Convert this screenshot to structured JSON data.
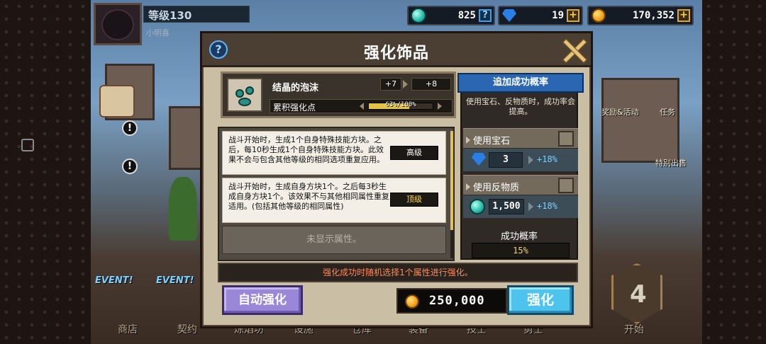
{
  "player": {
    "level": "等级130",
    "name": "小明喜"
  },
  "currency": [
    {
      "icon": "teal-gem-icon",
      "value": "825",
      "button": "?"
    },
    {
      "icon": "blue-diamond-icon",
      "value": "19",
      "button": "+"
    },
    {
      "icon": "gold-coin-icon",
      "value": "170,352",
      "button": "+"
    }
  ],
  "background": {
    "events": [
      "EVENT!",
      "EVENT!"
    ],
    "nav": [
      "商店",
      "契约",
      "炼焰坊",
      "设施",
      "仓库",
      "装备",
      "技士",
      "勇士",
      "开始"
    ],
    "side": [
      "奖励&活动",
      "任务",
      "特别出售"
    ],
    "start_number": "4"
  },
  "modal": {
    "title": "强化饰品",
    "help": "?",
    "item": {
      "name": "结晶的泡沫",
      "level_from": "+7",
      "level_to": "+8",
      "points_label": "累积强化点",
      "progress_text": "63%/100%",
      "progress_percent": 63
    },
    "effects": [
      {
        "text": "战斗开始时，生成1个自身特殊技能方块。之后，每10秒生成1个自身特殊技能方块。此效果不会与包含其他等级的相同选项重复应用。",
        "grade": "高级",
        "grade_color": "#ffffff"
      },
      {
        "text": "战斗开始时，生成自身方块1个。之后每3秒生成自身方块1个。该效果不与其他相同属性重复适用。(包括其他等级的相同属性)",
        "grade": "顶级",
        "grade_color": "#ffd84a"
      }
    ],
    "hidden_effect": "未显示属性。",
    "bonus": {
      "title": "追加成功概率",
      "desc": "使用宝石、反物质时，成功率会提高。",
      "gem_label": "使用宝石",
      "gem_amount": "3",
      "gem_bonus": "+18%",
      "antimatter_label": "使用反物质",
      "antimatter_amount": "1,500",
      "antimatter_bonus": "+18%",
      "rate_label": "成功概率",
      "rate_value": "15%"
    },
    "notice": "强化成功时随机选择1个属性进行强化。",
    "auto_button": "自动强化",
    "cost": "250,000",
    "enhance_button": "强化"
  },
  "colors": {
    "accent_blue": "#4cc4ee",
    "auto_purple": "#9a87d8",
    "notice_orange": "#ff8a5a",
    "gold": "#e4c248"
  }
}
